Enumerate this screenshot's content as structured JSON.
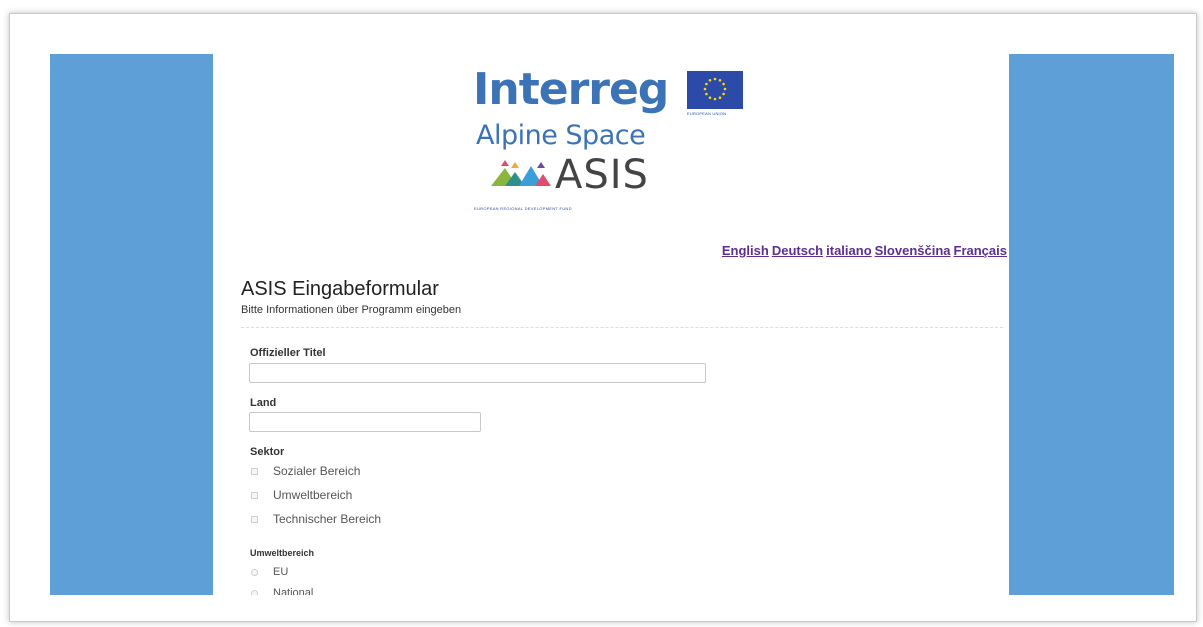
{
  "logo": {
    "interreg": "Interreg",
    "eu_label": "EUROPEAN UNION",
    "program": "Alpine Space",
    "project": "ASIS",
    "fund": "EUROPEAN REGIONAL DEVELOPMENT FUND"
  },
  "languages": [
    "English",
    "Deutsch",
    "italiano",
    "Slovenščina",
    "Français"
  ],
  "form": {
    "title": "ASIS Eingabeformular",
    "subtitle": "Bitte Informationen über Programm eingeben",
    "fields": {
      "official_title": {
        "label": "Offizieller Titel",
        "value": ""
      },
      "country": {
        "label": "Land",
        "value": ""
      }
    },
    "sector": {
      "label": "Sektor",
      "options": [
        "Sozialer Bereich",
        "Umweltbereich",
        "Technischer Bereich"
      ]
    },
    "environment": {
      "label": "Umweltbereich",
      "options": [
        "EU",
        "National"
      ]
    }
  },
  "colors": {
    "side_panel": "#5f9fd8",
    "link": "#5e2e91",
    "brand_blue": "#3c73b7"
  }
}
